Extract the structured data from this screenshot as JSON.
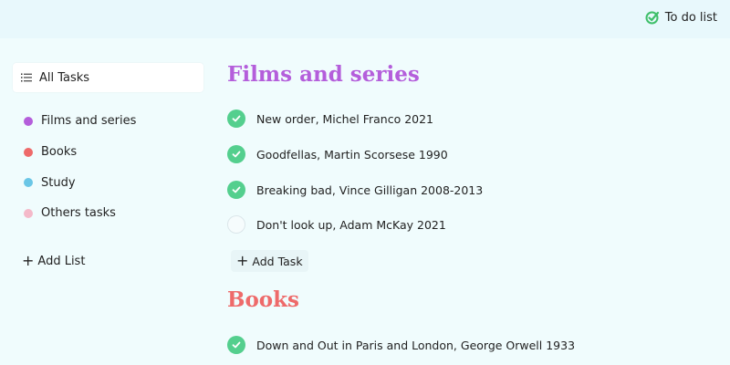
{
  "app": {
    "title": "To do list",
    "accent_color": "#3fbf6a"
  },
  "sidebar": {
    "all_tasks_label": "All Tasks",
    "lists": [
      {
        "label": "Films and series",
        "color": "#b45edb"
      },
      {
        "label": "Books",
        "color": "#ee6a6a"
      },
      {
        "label": "Study",
        "color": "#6ac6e6"
      },
      {
        "label": "Others tasks",
        "color": "#f4b9c9"
      }
    ],
    "add_list_label": "Add List"
  },
  "main": {
    "sections": [
      {
        "title": "Films and series",
        "color": "#b45edb",
        "tasks": [
          {
            "text": "New order, Michel Franco 2021",
            "done": true
          },
          {
            "text": "Goodfellas, Martin Scorsese 1990",
            "done": true
          },
          {
            "text": "Breaking bad, Vince Gilligan 2008-2013",
            "done": true
          },
          {
            "text": "Don't look up, Adam McKay 2021",
            "done": false
          }
        ],
        "add_task_label": "Add Task"
      },
      {
        "title": "Books",
        "color": "#ee6a6a",
        "tasks": [
          {
            "text": "Down and Out in Paris and London, George Orwell 1933",
            "done": true
          }
        ]
      }
    ]
  }
}
